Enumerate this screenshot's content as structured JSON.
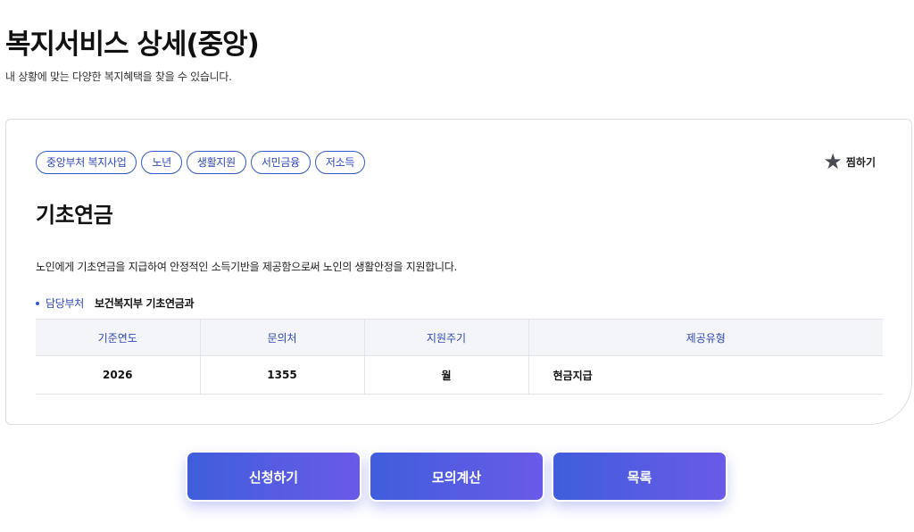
{
  "header": {
    "title": "복지서비스 상세(중앙)",
    "subtitle": "내 상황에 맞는 다양한 복지혜택을 찾을 수 있습니다."
  },
  "service": {
    "tags": [
      "중앙부처 복지사업",
      "노년",
      "생활지원",
      "서민금융",
      "저소득"
    ],
    "bookmark_label": "찜하기",
    "bookmark_icon": "star-icon",
    "name": "기초연금",
    "description": "노인에게 기초연금을 지급하여 안정적인 소득기반을 제공함으로써 노인의 생활안정을 지원합니다.",
    "dept_label": "담당부처",
    "dept_value": "보건복지부 기초연금과"
  },
  "table": {
    "headers": [
      "기준연도",
      "문의처",
      "지원주기",
      "제공유형"
    ],
    "row": [
      "2026",
      "1355",
      "월",
      "현금지급"
    ]
  },
  "actions": {
    "apply": "신청하기",
    "simulate": "모의계산",
    "list": "목록"
  },
  "colors": {
    "accent": "#2d47b8",
    "button_start": "#3f5edc",
    "button_end": "#6a5ae8"
  }
}
